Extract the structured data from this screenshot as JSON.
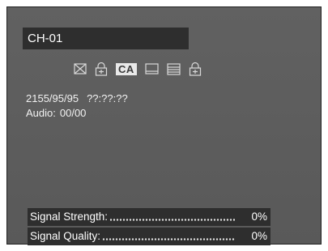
{
  "channel": {
    "name": "CH-01"
  },
  "status_icons": [
    {
      "icon": "scrambled-envelope-icon"
    },
    {
      "icon": "lock-icon"
    },
    {
      "icon": "ca-icon",
      "label": "CA"
    },
    {
      "icon": "subtitle-icon"
    },
    {
      "icon": "teletext-icon"
    },
    {
      "icon": "parental-lock-icon"
    }
  ],
  "info": {
    "date": "2155/95/95",
    "time": "??:??:??",
    "audio_label": "Audio:",
    "audio_value": "00/00"
  },
  "signal": {
    "strength_label": "Signal Strength:",
    "strength_value": "0%",
    "strength_level": 0,
    "quality_label": "Signal Quality:",
    "quality_value": "0%",
    "quality_level": 0
  },
  "colors": {
    "panel": "#5e5e5e",
    "bar": "#2e2e2e",
    "text": "#ffffff"
  }
}
